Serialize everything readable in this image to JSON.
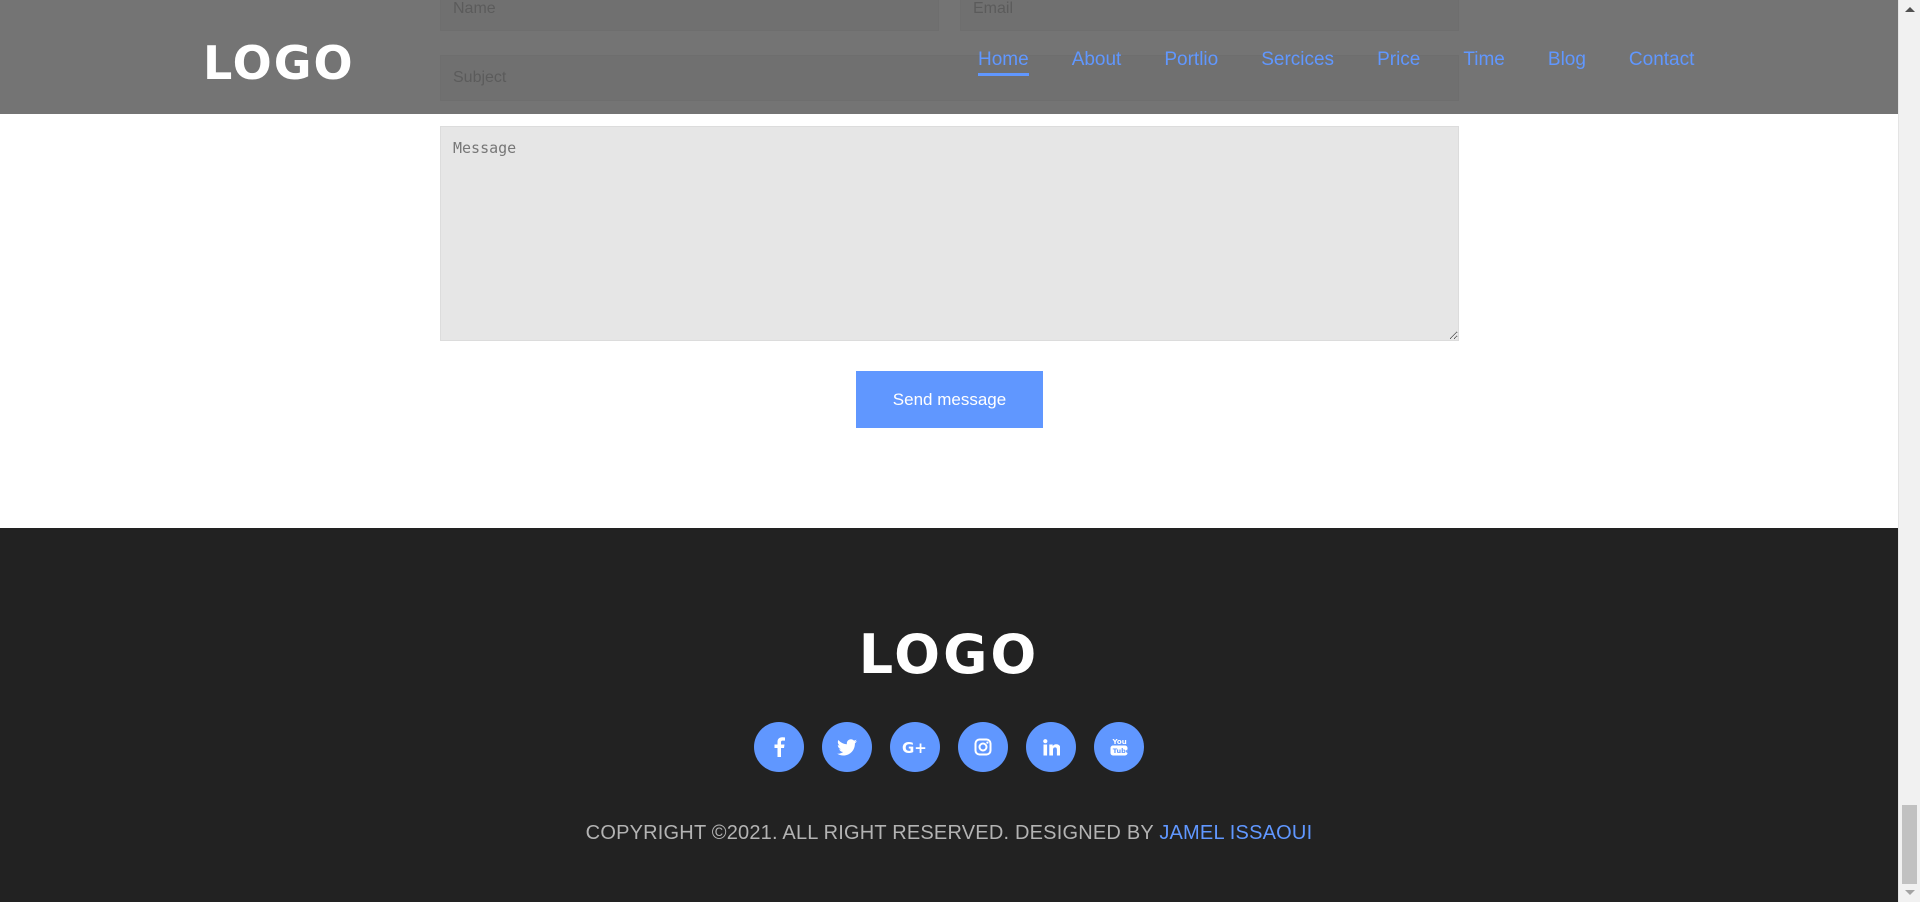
{
  "header": {
    "logo": "LOGO",
    "nav": [
      {
        "label": "Home",
        "active": true
      },
      {
        "label": "About"
      },
      {
        "label": "Portlio"
      },
      {
        "label": "Sercices"
      },
      {
        "label": "Price"
      },
      {
        "label": "Time"
      },
      {
        "label": "Blog"
      },
      {
        "label": "Contact"
      }
    ]
  },
  "form": {
    "name_placeholder": "Name",
    "email_placeholder": "Email",
    "subject_placeholder": "Subject",
    "message_placeholder": "Message",
    "send_label": "Send message"
  },
  "footer": {
    "logo": "LOGO",
    "socials": [
      {
        "icon": "facebook-icon"
      },
      {
        "icon": "twitter-icon"
      },
      {
        "icon": "google-plus-icon"
      },
      {
        "icon": "instagram-icon"
      },
      {
        "icon": "linkedin-icon"
      },
      {
        "icon": "youtube-icon"
      }
    ],
    "copyright_text": "COPYRIGHT ©2021. ALL RIGHT RESERVED. DESIGNED BY",
    "author": "JAMEL ISSAOUI"
  },
  "colors": {
    "accent": "#6097ff",
    "header_bg": "#555555",
    "footer_bg": "#222222",
    "field_bg": "#e6e6e6"
  }
}
